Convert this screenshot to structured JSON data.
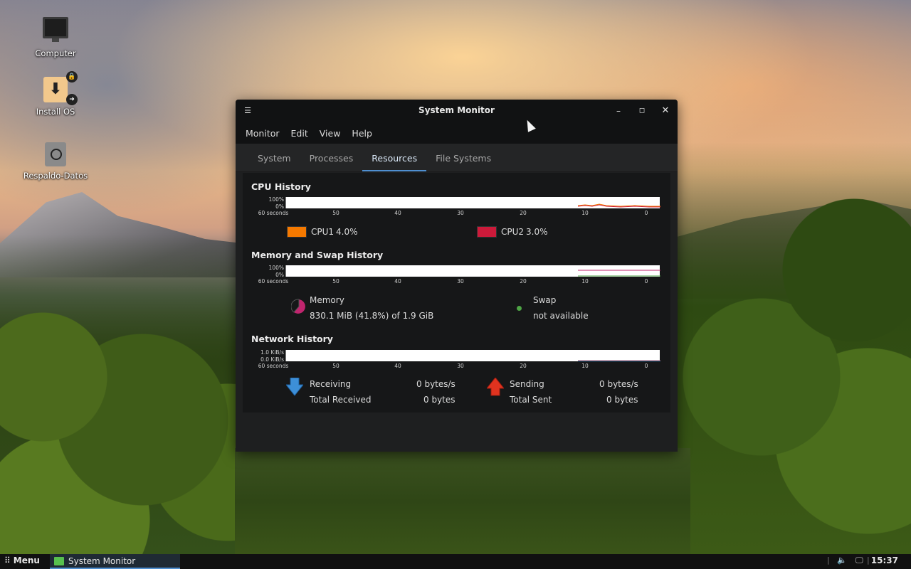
{
  "desktop": {
    "icons": [
      {
        "label": "Computer"
      },
      {
        "label": "Install OS"
      },
      {
        "label": "Respaldo-Datos"
      }
    ]
  },
  "window": {
    "title": "System Monitor",
    "menu": [
      "Monitor",
      "Edit",
      "View",
      "Help"
    ],
    "tabs": [
      "System",
      "Processes",
      "Resources",
      "File Systems"
    ],
    "active_tab": "Resources"
  },
  "cpu": {
    "title": "CPU History",
    "y_top": "100%",
    "y_bottom": "0%",
    "x_start": "60 seconds",
    "x_ticks": [
      "50",
      "40",
      "30",
      "20",
      "10",
      "0"
    ],
    "cpu1_label": "CPU1",
    "cpu1_value": "4.0%",
    "cpu1_color": "#f57900",
    "cpu2_label": "CPU2",
    "cpu2_value": "3.0%",
    "cpu2_color": "#cc1a3a"
  },
  "memory": {
    "title": "Memory and Swap History",
    "y_top": "100%",
    "y_bottom": "0%",
    "x_start": "60 seconds",
    "x_ticks": [
      "50",
      "40",
      "30",
      "20",
      "10",
      "0"
    ],
    "mem_label": "Memory",
    "mem_value": "830.1 MiB (41.8%) of 1.9 GiB",
    "mem_color": "#c0256e",
    "swap_label": "Swap",
    "swap_value": "not available",
    "swap_color": "#4ea545"
  },
  "network": {
    "title": "Network History",
    "y_top": "1.0 KiB/s",
    "y_bottom": "0.0 KiB/s",
    "x_start": "60 seconds",
    "x_ticks": [
      "50",
      "40",
      "30",
      "20",
      "10",
      "0"
    ],
    "receiving_label": "Receiving",
    "receiving_value": "0 bytes/s",
    "total_received_label": "Total Received",
    "total_received_value": "0 bytes",
    "sending_label": "Sending",
    "sending_value": "0 bytes/s",
    "total_sent_label": "Total Sent",
    "total_sent_value": "0 bytes",
    "receive_color": "#3d8fd8",
    "send_color": "#e0331f"
  },
  "taskbar": {
    "menu_label": "Menu",
    "task_label": "System Monitor",
    "clock": "15:37"
  }
}
